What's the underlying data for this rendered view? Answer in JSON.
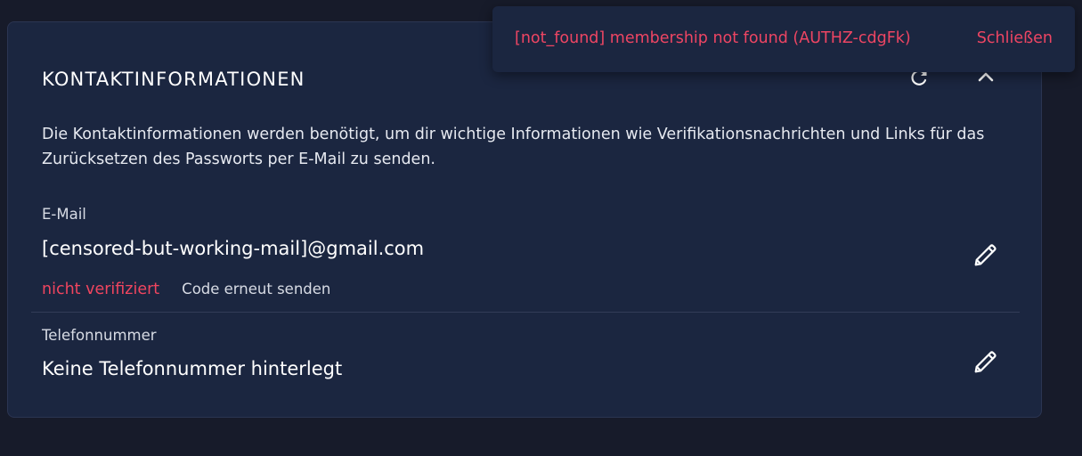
{
  "card": {
    "title": "KONTAKTINFORMATIONEN",
    "description": "Die Kontaktinformationen werden benötigt, um dir wichtige Informationen wie Verifikationsnachrichten und Links für das Zurücksetzen des Passworts per E-Mail zu senden.",
    "refresh_icon": "refresh-icon",
    "collapse_icon": "chevron-up-icon"
  },
  "email": {
    "label": "E-Mail",
    "value": "[censored-but-working-mail]@gmail.com",
    "status": "nicht verifiziert",
    "resend_label": "Code erneut senden",
    "edit_icon": "pencil-icon"
  },
  "phone": {
    "label": "Telefonnummer",
    "value": "Keine Telefonnummer hinterlegt",
    "edit_icon": "pencil-icon"
  },
  "toast": {
    "message": "[not_found] membership not found (AUTHZ-cdgFk)",
    "close_label": "Schließen"
  },
  "colors": {
    "background": "#171b2a",
    "card": "#1b2640",
    "error": "#f0455f",
    "text": "#ffffff"
  }
}
